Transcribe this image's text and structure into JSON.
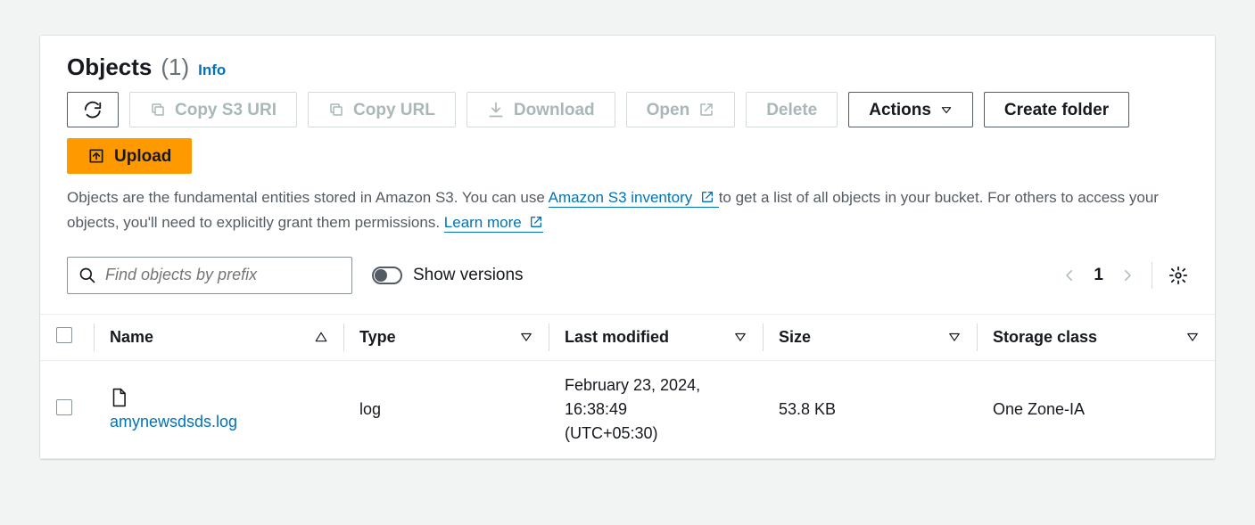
{
  "header": {
    "title": "Objects",
    "count_display": "(1)",
    "info_label": "Info"
  },
  "toolbar": {
    "copy_s3_uri": "Copy S3 URI",
    "copy_url": "Copy URL",
    "download": "Download",
    "open": "Open",
    "delete": "Delete",
    "actions": "Actions",
    "create_folder": "Create folder",
    "upload": "Upload"
  },
  "description": {
    "part1": "Objects are the fundamental entities stored in Amazon S3. You can use ",
    "inventory_link": "Amazon S3 inventory",
    "part2": " to get a list of all objects in your bucket. For others to access your objects, you'll need to explicitly grant them permissions. ",
    "learn_more": "Learn more"
  },
  "filter": {
    "placeholder": "Find objects by prefix",
    "show_versions_label": "Show versions"
  },
  "pagination": {
    "page": "1"
  },
  "table": {
    "columns": {
      "name": "Name",
      "type": "Type",
      "last_modified": "Last modified",
      "size": "Size",
      "storage_class": "Storage class"
    },
    "rows": [
      {
        "name": "amynewsdsds.log",
        "type": "log",
        "last_modified_line1": "February 23, 2024,",
        "last_modified_line2": "16:38:49",
        "last_modified_line3": "(UTC+05:30)",
        "size": "53.8 KB",
        "storage_class": "One Zone-IA"
      }
    ]
  }
}
